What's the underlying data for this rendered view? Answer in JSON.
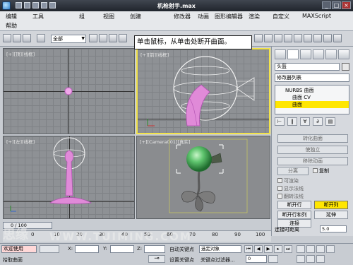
{
  "window": {
    "title": "机枪射手.max"
  },
  "menubar": {
    "items": [
      "编辑",
      "工具",
      "组",
      "视图",
      "创建",
      "修改器",
      "动画",
      "图形编辑器",
      "渲染",
      "自定义",
      "MAXScript"
    ],
    "help": "帮助"
  },
  "toolbar": {
    "selection_filter": "全部"
  },
  "tooltip": {
    "text": "单击鼠标，从单击处断开曲面。"
  },
  "viewports": {
    "top": {
      "label": "[+][顶][线框]"
    },
    "front": {
      "label": "[+][前][线框]"
    },
    "left": {
      "label": "[+][左][线框]"
    },
    "camera": {
      "label": "[+][Camera001][真实]"
    }
  },
  "command_panel": {
    "object_name": "头盔",
    "modifier_list": "修改器列表",
    "stack": [
      "NURBS 曲面",
      "曲面 CV",
      "曲面"
    ],
    "stack_selected": 2,
    "buttons": {
      "make_rigid": "转化曲面",
      "make_independent": "使独立",
      "remove_animation": "移除动画",
      "detach": "分离",
      "copy": "复制",
      "break_row": "断开行",
      "break_col": "断开列",
      "break_row_col": "断开行和列",
      "extend": "延伸",
      "join": "连接"
    },
    "checkboxes": {
      "renderable": "可渲染",
      "display_normals": "显示法线",
      "flip_normals": "翻转法线"
    },
    "connect_distance": {
      "label": "连接时距离",
      "value": "5.0"
    }
  },
  "timeline": {
    "slider": "0 / 100",
    "ticks": [
      "0",
      "10",
      "20",
      "30",
      "40",
      "50",
      "60",
      "70",
      "80",
      "90",
      "100"
    ]
  },
  "statusbar": {
    "welcome": "欢迎使用",
    "prompt": "拾取曲面",
    "x_label": "X:",
    "y_label": "Y:",
    "z_label": "Z:",
    "auto_key": "自动关键点",
    "set_key": "设置关键点",
    "selected_object": "选定对象",
    "key_filters": "关键点过滤器...",
    "frame_value": "0"
  },
  "watermark": {
    "text": "WWW.TUIMING.COM",
    "text2": "思缘"
  },
  "colors": {
    "accent_yellow": "#ffe600",
    "viewport_bg": "#8e9195",
    "wire_pink": "#e08ad8",
    "object_green": "#5fc46e"
  }
}
